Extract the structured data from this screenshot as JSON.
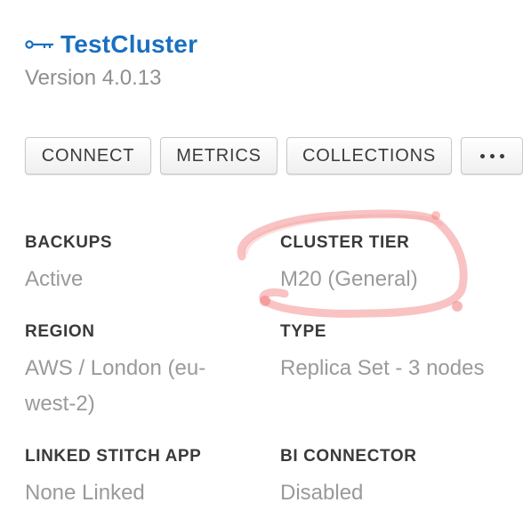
{
  "cluster": {
    "title": "TestCluster",
    "version": "Version 4.0.13",
    "title_color": "#1a6fc0",
    "icon": "key-icon"
  },
  "actions": {
    "connect": "CONNECT",
    "metrics": "METRICS",
    "collections": "COLLECTIONS",
    "more": "more-options-icon"
  },
  "details": {
    "backups": {
      "label": "BACKUPS",
      "value": "Active"
    },
    "cluster_tier": {
      "label": "CLUSTER TIER",
      "value": "M20 (General)"
    },
    "region": {
      "label": "REGION",
      "value": "AWS / London (eu-west-2)"
    },
    "type": {
      "label": "TYPE",
      "value": "Replica Set - 3 nodes"
    },
    "linked_stitch_app": {
      "label": "LINKED STITCH APP",
      "value": "None Linked"
    },
    "bi_connector": {
      "label": "BI CONNECTOR",
      "value": "Disabled"
    }
  },
  "annotation": {
    "shape": "hand-drawn-circle",
    "color": "#f27b7b"
  }
}
